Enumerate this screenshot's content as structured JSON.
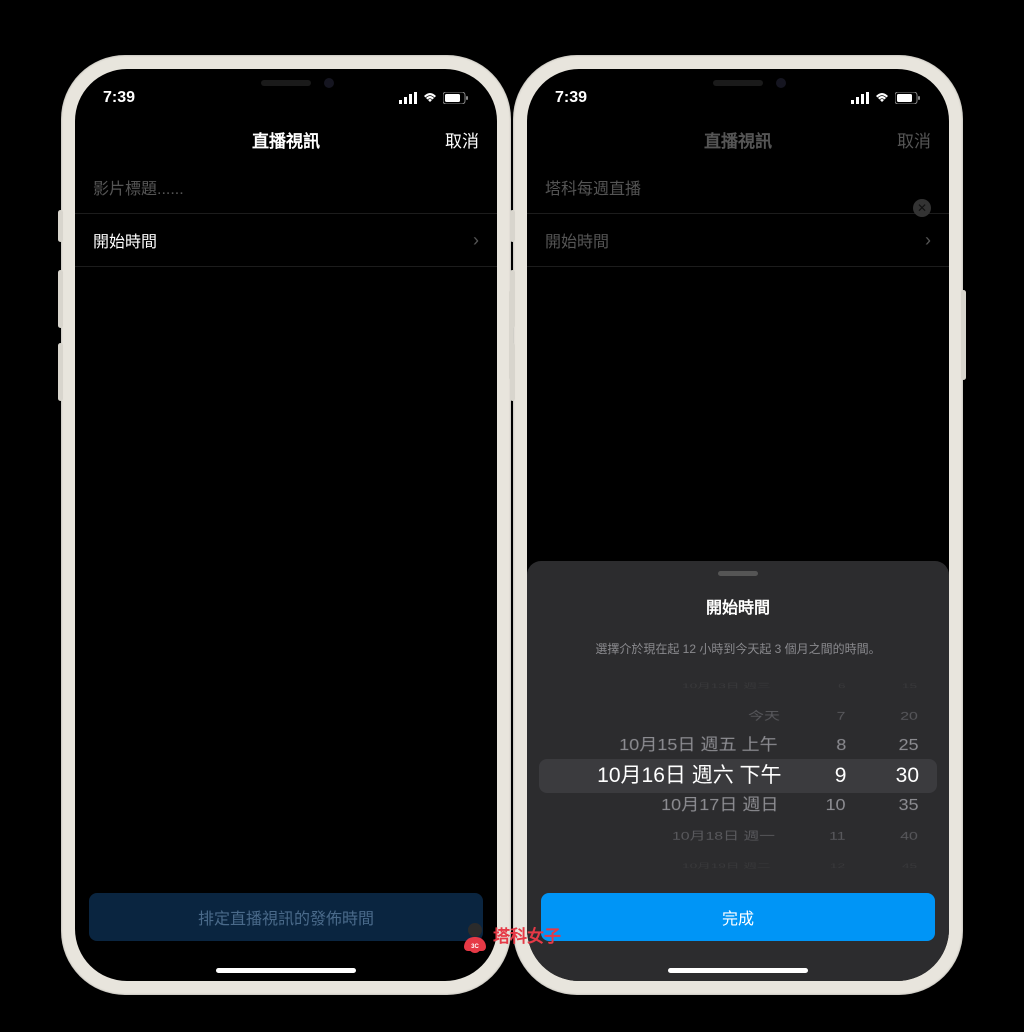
{
  "status": {
    "time": "7:39"
  },
  "left_phone": {
    "nav": {
      "title": "直播視訊",
      "cancel": "取消"
    },
    "title_input": {
      "placeholder": "影片標題......"
    },
    "rows": {
      "start_time": "開始時間"
    },
    "bottom_button": "排定直播視訊的發佈時間"
  },
  "right_phone": {
    "nav": {
      "title": "直播視訊",
      "cancel": "取消"
    },
    "title_input": {
      "value": "塔科每週直播"
    },
    "rows": {
      "start_time": "開始時間"
    },
    "sheet": {
      "title": "開始時間",
      "subtitle": "選擇介於現在起 12 小時到今天起 3 個月之間的時間。",
      "done_button": "完成",
      "picker": {
        "dates": [
          "10月13日 週三",
          "今天",
          "10月15日 週五 上午",
          "10月16日 週六 下午",
          "10月17日 週日",
          "10月18日 週一",
          "10月19日 週二"
        ],
        "hours": [
          "6",
          "7",
          "8",
          "9",
          "10",
          "11",
          "12"
        ],
        "minutes": [
          "15",
          "20",
          "25",
          "30",
          "35",
          "40",
          "45"
        ]
      }
    }
  },
  "watermark": {
    "text": "塔科女子",
    "badge": "3C"
  }
}
